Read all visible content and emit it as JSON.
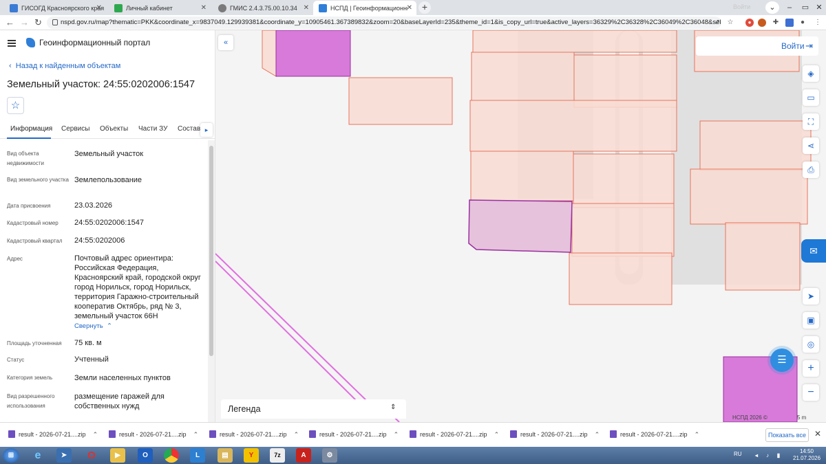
{
  "browser": {
    "tabs": [
      {
        "title": "ГИСОГД Красноярского края",
        "favicon_color": "#3a7bd5"
      },
      {
        "title": "Личный кабинет",
        "favicon_color": "#2ea84f"
      },
      {
        "title": "ГМИС 2.4.3.75.00.10.34",
        "favicon_color": "#7a7a7a"
      },
      {
        "title": "НСПД | Геоинформационный п...",
        "favicon_color": "#2f7fd8"
      }
    ],
    "url": "nspd.gov.ru/map?thematic=PKK&coordinate_x=9837049.129939381&coordinate_y=10905461.367389832&zoom=20&baseLayerId=235&theme_id=1&is_copy_url=true&active_layers=36329%2C36328%2C36049%2C36048&selectedCard=171...",
    "profile_ghost": "Войти"
  },
  "panel": {
    "portal_title": "Геоинформационный портал",
    "back_link": "Назад к найденным объектам",
    "parcel_title": "Земельный участок: 24:55:0202006:1547",
    "tabs": [
      "Информация",
      "Сервисы",
      "Объекты",
      "Части ЗУ",
      "Состав"
    ],
    "attributes": [
      {
        "label": "Вид объекта недвижимости",
        "value": "Земельный участок"
      },
      {
        "label": "Вид земельного участка",
        "value": "Землепользование"
      },
      {
        "label": "Дата присвоения",
        "value": "23.03.2026"
      },
      {
        "label": "Кадастровый номер",
        "value": "24:55:0202006:1547"
      },
      {
        "label": "Кадастровый квартал",
        "value": "24:55:0202006"
      },
      {
        "label": "Адрес",
        "value": "Почтовый адрес ориентира: Российская Федерация, Красноярский край, городской округ город Норильск, город Норильск, территория Гаражно-строительный кооператив Октябрь, ряд № 3, земельный участок 66Н"
      },
      {
        "label": "Площадь уточненная",
        "value": "75 кв. м"
      },
      {
        "label": "Статус",
        "value": "Учтенный"
      },
      {
        "label": "Категория земель",
        "value": "Земли населенных пунктов"
      },
      {
        "label": "Вид разрешенного использования",
        "value": "размещение гаражей для собственных нужд"
      }
    ],
    "collapse_link": "Свернуть"
  },
  "map": {
    "login_label": "Войти",
    "legend_title": "Легенда",
    "copyright": "НСПД 2026 ©",
    "scale_label": "5 m",
    "colors": {
      "parcel_fill": "#f8dcd4",
      "parcel_stroke": "#e8735a",
      "selected_fill": "#e6c2dc",
      "selected_stroke": "#9a2fa0",
      "magenta_fill": "#d77ad9",
      "accent": "#2468c8"
    }
  },
  "downloads": {
    "items": [
      "result - 2026-07-21....zip",
      "result - 2026-07-21....zip",
      "result - 2026-07-21....zip",
      "result - 2026-07-21....zip",
      "result - 2026-07-21....zip",
      "result - 2026-07-21....zip",
      "result - 2026-07-21....zip"
    ],
    "show_all": "Показать все"
  },
  "taskbar": {
    "lang": "RU",
    "time": "14:50",
    "date": "21.07.2026"
  }
}
